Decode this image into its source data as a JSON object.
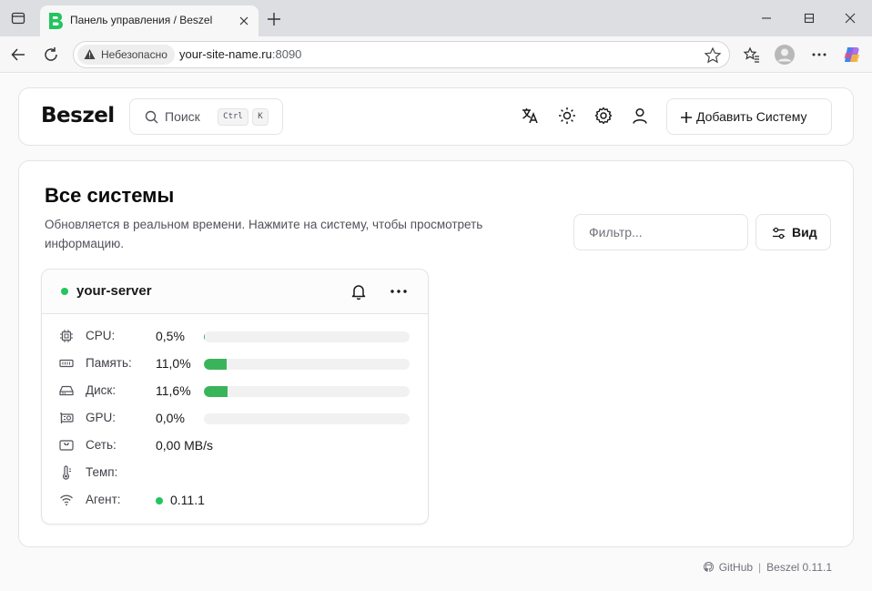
{
  "browser": {
    "tab_title": "Панель управления / Beszel",
    "security_label": "Небезопасно",
    "url_host": "your-site-name.ru",
    "url_port": ":8090"
  },
  "header": {
    "logo": "Beszel",
    "search_label": "Поиск",
    "search_kbd_ctrl": "Ctrl",
    "search_kbd_key": "K",
    "add_system_label": "Добавить Систему"
  },
  "main": {
    "title": "Все системы",
    "subtitle": "Обновляется в реальном времени. Нажмите на систему, чтобы просмотреть информацию.",
    "filter_placeholder": "Фильтр...",
    "view_label": "Вид"
  },
  "system": {
    "name": "your-server",
    "status_color": "#22c55e",
    "metrics": [
      {
        "label": "CPU:",
        "value": "0,5%",
        "percent": 0.5,
        "icon": "cpu-icon"
      },
      {
        "label": "Память:",
        "value": "11,0%",
        "percent": 11.0,
        "icon": "memory-icon"
      },
      {
        "label": "Диск:",
        "value": "11,6%",
        "percent": 11.6,
        "icon": "disk-icon"
      },
      {
        "label": "GPU:",
        "value": "0,0%",
        "percent": 0.0,
        "icon": "gpu-icon"
      },
      {
        "label": "Сеть:",
        "value": "0,00 MB/s",
        "icon": "network-icon"
      },
      {
        "label": "Темп:",
        "value": "",
        "icon": "thermometer-icon"
      },
      {
        "label": "Агент:",
        "value": "0.11.1",
        "icon": "wifi-icon"
      }
    ]
  },
  "footer": {
    "github_label": "GitHub",
    "separator": "|",
    "version_label": "Beszel 0.11.1"
  },
  "colors": {
    "accent_green": "#3ab45a",
    "text_primary": "#18181b",
    "border": "#e4e4e7"
  }
}
